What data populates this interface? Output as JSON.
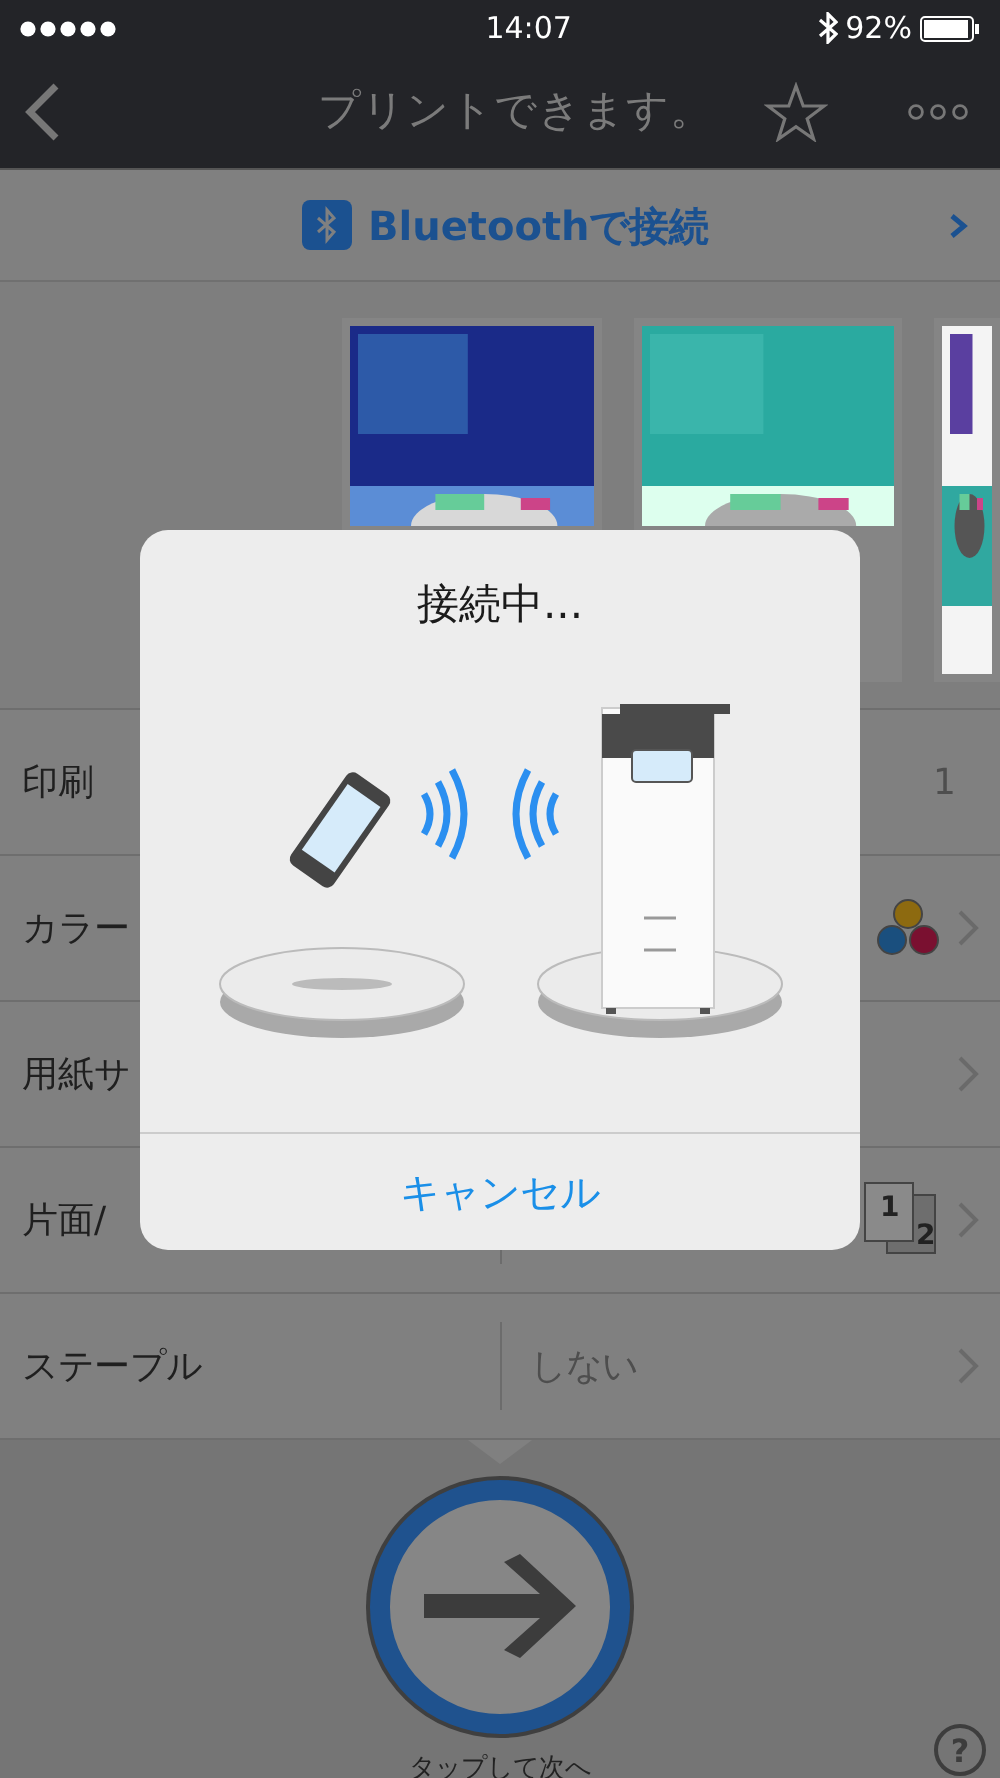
{
  "status_bar": {
    "time": "14:07",
    "battery": "92%"
  },
  "nav": {
    "title": "プリントできます。"
  },
  "bluetooth_button": {
    "label": "Bluetoothで接続"
  },
  "settings": [
    {
      "kind": "count",
      "label": "印刷",
      "value": "1"
    },
    {
      "kind": "color",
      "label": "カラー"
    },
    {
      "kind": "choice",
      "label": "用紙サ"
    },
    {
      "kind": "sides",
      "label": "片面/",
      "front": "1",
      "back": "2"
    },
    {
      "kind": "choice",
      "label": "ステープル",
      "value": "しない"
    }
  ],
  "dialog": {
    "title": "接続中...",
    "cancel": "キャンセル"
  },
  "next_button": {
    "caption": "タップして次へ"
  },
  "help": "?"
}
